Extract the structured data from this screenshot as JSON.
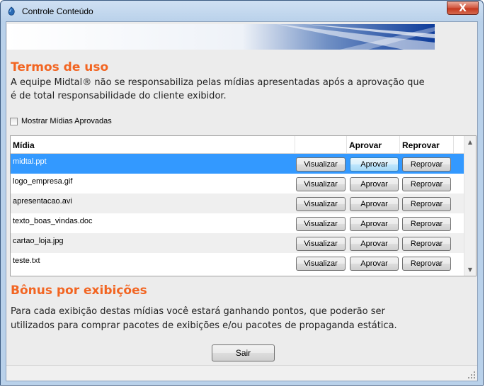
{
  "window": {
    "title": "Controle Conteúdo",
    "close_label": "X"
  },
  "terms": {
    "heading": "Termos de uso",
    "line1": "A equipe Midtal® não se responsabiliza pelas mídias apresentadas após a aprovação que",
    "line2": "é de total responsabilidade do cliente exibidor."
  },
  "show_approved": {
    "label": "Mostrar Mídias Aprovadas",
    "checked": false
  },
  "grid": {
    "columns": {
      "media": "Mídia",
      "view": "",
      "approve": "Aprovar",
      "reject": "Reprovar"
    },
    "button_labels": {
      "view": "Visualizar",
      "approve": "Aprovar",
      "reject": "Reprovar"
    },
    "rows": [
      {
        "file": "midtal.ppt",
        "selected": true
      },
      {
        "file": "logo_empresa.gif",
        "selected": false
      },
      {
        "file": "apresentacao.avi",
        "selected": false
      },
      {
        "file": "texto_boas_vindas.doc",
        "selected": false
      },
      {
        "file": "cartao_loja.jpg",
        "selected": false
      },
      {
        "file": "teste.txt",
        "selected": false
      }
    ]
  },
  "bonus": {
    "heading": "Bônus por exibições",
    "line1": "Para cada exibição destas mídias você estará ganhando pontos, que poderão ser",
    "line2": "utilizados para comprar pacotes de exibições e/ou pacotes de propaganda estática."
  },
  "exit_label": "Sair",
  "colors": {
    "accent_orange": "#f26522",
    "selection_blue": "#3399ff"
  }
}
